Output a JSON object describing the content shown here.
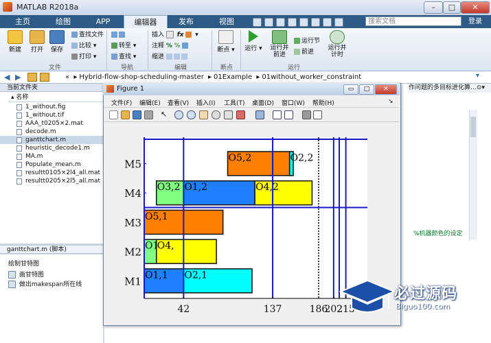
{
  "window": {
    "title": "MATLAB R2018a"
  },
  "ribbon_tabs": [
    "主页",
    "绘图",
    "APP",
    "编辑器",
    "发布",
    "视图"
  ],
  "search": {
    "placeholder": "搜索文档"
  },
  "login_label": "登录",
  "ribbon": {
    "file_buttons": [
      "新建",
      "打开",
      "保存"
    ],
    "file_small": [
      "查找文件",
      "比较",
      "打印"
    ],
    "nav_small": [
      "转至",
      "查找"
    ],
    "edit_small": [
      "插入",
      "注释",
      "缩进"
    ],
    "breakpoint": "断点",
    "run_buttons": [
      "运行",
      "运行并\n前进",
      "运行节",
      "前进",
      "运行并\n计时"
    ],
    "groups": [
      "文件",
      "导航",
      "编辑",
      "断点",
      "运行"
    ]
  },
  "breadcrumb": {
    "segments": [
      "«",
      "Hybrid-flow-shop-scheduling-master",
      "01Example",
      "01without_worker_constraint"
    ]
  },
  "current_folder": {
    "header": "当前文件夹",
    "column": "名称",
    "files": [
      "1_without.fig",
      "1_without.tif",
      "AAA_t0205×2.mat",
      "decode.m",
      "ganttchart.m",
      "heuristic_decode1.m",
      "MA.m",
      "Populate_mean.m",
      "resultt0105×2l4_all.mat",
      "resultt0205×2l5_all.mat"
    ],
    "selected_index": 4
  },
  "details": {
    "header": "ganttchart.m  (脚本)",
    "description": "绘制甘特图",
    "items": [
      "画甘特图",
      "做出makespan所在线"
    ]
  },
  "editor": {
    "header_text": "作问题的多目标进化算…",
    "hint": "%机器颜色的设定"
  },
  "figure": {
    "title": "Figure 1",
    "menu": [
      "文件(F)",
      "编辑(E)",
      "查看(V)",
      "插入(I)",
      "工具(T)",
      "桌面(D)",
      "窗口(W)",
      "帮助(H)"
    ],
    "win_buttons": [
      "▭",
      "□",
      "✕"
    ]
  },
  "chart_data": {
    "type": "gantt",
    "title": "",
    "xlabel": "",
    "ylabel": "",
    "machines": [
      "M1",
      "M2",
      "M3",
      "M4",
      "M5"
    ],
    "xlim": [
      0,
      238
    ],
    "x_ticks": [
      42,
      137,
      186,
      202,
      215
    ],
    "x_tick_labels": [
      "42",
      "137",
      "186",
      "202",
      "215"
    ],
    "tasks": [
      {
        "machine": "M1",
        "label": "O1,1",
        "start": 0,
        "end": 42,
        "color": "#1f7fff"
      },
      {
        "machine": "M1",
        "label": "O2,1",
        "start": 42,
        "end": 115,
        "color": "#00ffff"
      },
      {
        "machine": "M2",
        "label": "O1,",
        "start": 0,
        "end": 13,
        "color": "#80ff80"
      },
      {
        "machine": "M2",
        "label": "O4,",
        "start": 13,
        "end": 77,
        "color": "#ffff00"
      },
      {
        "machine": "M3",
        "label": "O5,1",
        "start": 0,
        "end": 84,
        "color": "#ff8000"
      },
      {
        "machine": "M4",
        "label": "O3,2",
        "start": 13,
        "end": 42,
        "color": "#80ff80"
      },
      {
        "machine": "M4",
        "label": "O1,2",
        "start": 42,
        "end": 118,
        "color": "#1f7fff"
      },
      {
        "machine": "M4",
        "label": "O4,2",
        "start": 118,
        "end": 179,
        "color": "#ffff00"
      },
      {
        "machine": "M5",
        "label": "O5,2",
        "start": 89,
        "end": 155,
        "color": "#ff8000"
      },
      {
        "machine": "M5",
        "label": "O2,2",
        "start": 155,
        "end": 159,
        "color": "#00ffff"
      }
    ],
    "vlines": [
      {
        "x": 0,
        "style": "solid"
      },
      {
        "x": 42,
        "style": "solid"
      },
      {
        "x": 137,
        "style": "solid"
      },
      {
        "x": 186,
        "style": "dotted-black"
      },
      {
        "x": 202,
        "style": "solid"
      },
      {
        "x": 208,
        "style": "solid"
      },
      {
        "x": 215,
        "style": "solid"
      }
    ],
    "hlines": [
      {
        "y_between": [
          "M3",
          "M4"
        ]
      },
      {
        "y_between": [
          "M5",
          "top"
        ]
      }
    ],
    "line_color": "#1818c8",
    "grid": false
  },
  "watermark": {
    "text": "必过源码",
    "url": "Biguo100.com"
  }
}
